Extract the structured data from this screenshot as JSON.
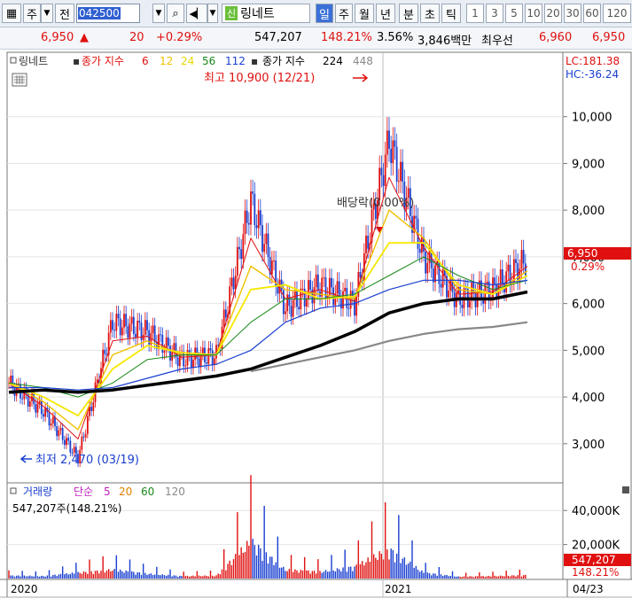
{
  "toolbar": {
    "market_label": "주",
    "view_label": "전",
    "stock_code": "042500",
    "stock_name_badge": "신",
    "stock_name": "링네트",
    "periods": [
      "일",
      "주",
      "월",
      "년",
      "분",
      "초",
      "틱"
    ],
    "active_period": "일",
    "intervals": [
      "1",
      "3",
      "5",
      "10",
      "20",
      "30",
      "60",
      "120"
    ]
  },
  "quote": {
    "price": "6,950",
    "change_arrow": "▲",
    "change": "20",
    "change_pct": "+0.29%",
    "volume": "547,207",
    "volume_ratio": "148.21%",
    "turnover_ratio": "3.56%",
    "amount": "3,846백만",
    "bid_label": "최우선",
    "bid": "6,960",
    "ask": "6,950"
  },
  "price_legend": {
    "name": "링네트",
    "ma_label": "종가 지수",
    "ma_periods": [
      "6",
      "12",
      "24",
      "56",
      "112"
    ],
    "ma2_label": "종가 지수",
    "ma2_periods": [
      "224",
      "448"
    ],
    "lc": "LC:181.38",
    "hc": "HC:-36.24"
  },
  "annotations": {
    "high": "최고 10,900 (12/21)",
    "low": "최저 2,470 (03/19)",
    "dividend": "배당락(0.00%)",
    "last_price_box": "6,950",
    "last_change_box": "0.29%"
  },
  "volume_legend": {
    "title": "거래량",
    "ma_label": "단순",
    "ma_periods": [
      "5",
      "20",
      "60",
      "120"
    ],
    "value": "547,207주(148.21%)",
    "last_box": "547,207",
    "last_ratio": "148.21%"
  },
  "xaxis": {
    "labels": [
      "2020",
      "2021"
    ],
    "right_date": "04/23"
  },
  "colors": {
    "up": "#e01010",
    "down": "#1a3fd0",
    "ma6": "#e01010",
    "ma12": "#f0c000",
    "ma24": "#f5e800",
    "ma56": "#1a8a1a",
    "ma112": "#1a3fd0",
    "ma224": "#000000",
    "ma448": "#888888"
  },
  "chart_data": [
    {
      "type": "line",
      "title": "링네트",
      "yaxis_ticks": [
        3000,
        4000,
        5000,
        6000,
        7000,
        8000,
        9000,
        10000
      ],
      "ylim": [
        2200,
        11000
      ],
      "x": [
        "2020-01",
        "2020-02",
        "2020-03",
        "2020-04",
        "2020-05",
        "2020-06",
        "2020-07",
        "2020-08",
        "2020-09",
        "2020-10",
        "2020-11",
        "2020-12",
        "2021-01",
        "2021-02",
        "2021-03",
        "2021-04"
      ],
      "series": [
        {
          "name": "종가",
          "values": [
            4300,
            3700,
            2700,
            5600,
            5400,
            4800,
            4900,
            8200,
            5900,
            6400,
            6000,
            9500,
            7000,
            6100,
            6300,
            6950
          ]
        },
        {
          "name": "6",
          "values": [
            4300,
            3800,
            3100,
            5200,
            5300,
            4850,
            4900,
            7400,
            6100,
            6300,
            6050,
            8700,
            7200,
            6200,
            6250,
            6800
          ]
        },
        {
          "name": "12",
          "values": [
            4300,
            3900,
            3300,
            4900,
            5200,
            4900,
            4900,
            6800,
            6300,
            6200,
            6100,
            8000,
            7400,
            6300,
            6200,
            6700
          ]
        },
        {
          "name": "24",
          "values": [
            4300,
            4000,
            3600,
            4600,
            5100,
            4950,
            4900,
            6300,
            6400,
            6100,
            6150,
            7300,
            7300,
            6400,
            6200,
            6600
          ]
        },
        {
          "name": "56",
          "values": [
            4300,
            4200,
            4000,
            4300,
            4800,
            4900,
            4900,
            5600,
            6100,
            6100,
            6200,
            6600,
            7000,
            6600,
            6300,
            6500
          ]
        },
        {
          "name": "112",
          "values": [
            4200,
            4200,
            4150,
            4200,
            4400,
            4600,
            4700,
            5000,
            5600,
            5900,
            6000,
            6300,
            6500,
            6500,
            6400,
            6500
          ]
        },
        {
          "name": "224",
          "values": [
            4100,
            4150,
            4100,
            4150,
            4250,
            4350,
            4450,
            4600,
            4850,
            5100,
            5400,
            5800,
            6000,
            6100,
            6100,
            6250
          ]
        },
        {
          "name": "448",
          "values": [
            null,
            null,
            null,
            null,
            null,
            null,
            null,
            4550,
            4700,
            4850,
            5000,
            5200,
            5350,
            5450,
            5500,
            5600
          ]
        }
      ]
    },
    {
      "type": "bar",
      "title": "거래량",
      "yaxis_ticks": [
        20000,
        40000
      ],
      "ytick_labels": [
        "20,000K",
        "40,000K"
      ],
      "ylim": [
        0,
        50000
      ],
      "x": [
        "2020-01",
        "2020-02",
        "2020-03",
        "2020-04",
        "2020-05",
        "2020-06",
        "2020-07",
        "2020-08",
        "2020-09",
        "2020-10",
        "2020-11",
        "2020-12",
        "2021-01",
        "2021-02",
        "2021-03",
        "2021-04"
      ],
      "values": [
        3000,
        2500,
        6000,
        9000,
        5000,
        2500,
        3000,
        38000,
        9000,
        7000,
        12000,
        30000,
        6000,
        2000,
        2500,
        3500
      ]
    }
  ]
}
